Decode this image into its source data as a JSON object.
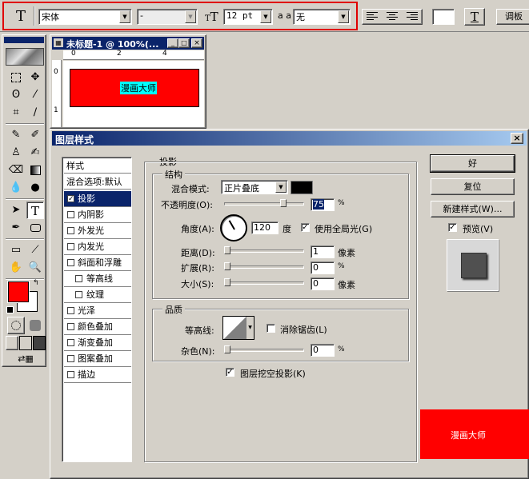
{
  "options_bar": {
    "tool_icon": "T",
    "font_family": "宋体",
    "font_style": "-",
    "font_size": "12 pt",
    "aa_label": "a a",
    "aa_value": "无",
    "palette_label": "调板"
  },
  "doc_window": {
    "title": "未标题-1 @ 100%(...",
    "canvas_text": "漫画大师",
    "canvas_color": "#ff0000",
    "ruler_h": [
      "0",
      "2",
      "4"
    ],
    "ruler_v": [
      "0",
      "1"
    ]
  },
  "dialog": {
    "title": "图层样式",
    "close": "×",
    "nav_header": "样式",
    "nav_blend": "混合选项:默认",
    "nav_items": [
      {
        "label": "投影",
        "checked": true,
        "selected": true
      },
      {
        "label": "内阴影",
        "checked": false
      },
      {
        "label": "外发光",
        "checked": false
      },
      {
        "label": "内发光",
        "checked": false
      },
      {
        "label": "斜面和浮雕",
        "checked": false
      },
      {
        "label": "等高线",
        "checked": false,
        "indent": true
      },
      {
        "label": "纹理",
        "checked": false,
        "indent": true
      },
      {
        "label": "光泽",
        "checked": false
      },
      {
        "label": "颜色叠加",
        "checked": false
      },
      {
        "label": "渐变叠加",
        "checked": false
      },
      {
        "label": "图案叠加",
        "checked": false
      },
      {
        "label": "描边",
        "checked": false
      }
    ],
    "section_title": "投影",
    "structure": {
      "title": "结构",
      "blend_label": "混合模式:",
      "blend_mode": "正片叠底",
      "shadow_color": "#000000",
      "opacity_label": "不透明度(O):",
      "opacity_value": "75",
      "percent": "%",
      "angle_label": "角度(A):",
      "angle_value": "120",
      "degree_label": "度",
      "global_light_label": "使用全局光(G)",
      "global_light_checked": true,
      "distance_label": "距离(D):",
      "distance_value": "1",
      "distance_unit": "像素",
      "spread_label": "扩展(R):",
      "spread_value": "0",
      "size_label": "大小(S):",
      "size_value": "0",
      "size_unit": "像素"
    },
    "quality": {
      "title": "品质",
      "contour_label": "等高线:",
      "anti_alias_label": "消除锯齿(L)",
      "noise_label": "杂色(N):",
      "noise_value": "0",
      "percent": "%"
    },
    "knockout_label": "图层挖空投影(K)",
    "buttons": {
      "ok": "好",
      "reset": "复位",
      "new_style": "新建样式(W)...",
      "preview_label": "预览(V)"
    },
    "preview_text": "漫画大师"
  }
}
